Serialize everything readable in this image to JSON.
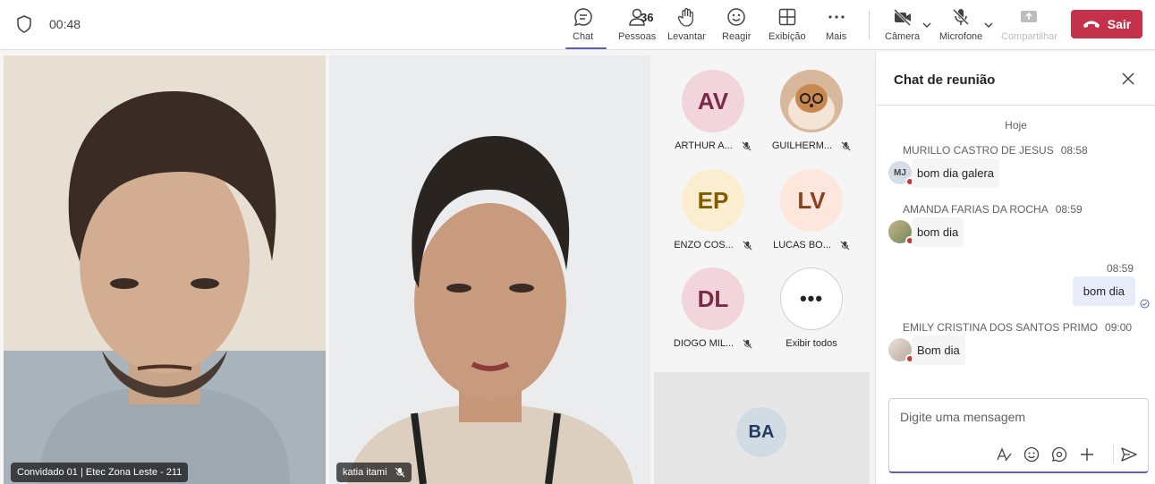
{
  "meeting": {
    "timer": "00:48"
  },
  "toolbar": {
    "chat": "Chat",
    "people": "Pessoas",
    "people_count": "36",
    "raise": "Levantar",
    "react": "Reagir",
    "view": "Exibição",
    "more": "Mais",
    "camera": "Câmera",
    "mic": "Microfone",
    "share": "Compartilhar",
    "leave": "Sair",
    "leave_color": "#c4314b",
    "accent": "#5b5fc7"
  },
  "videos": {
    "left_name": "Convidado 01 | Etec Zona Leste - 211",
    "center_name": "katia itami"
  },
  "participants": [
    {
      "initials": "AV",
      "name": "ARTHUR A...",
      "bg": "#f1d4dc",
      "fg": "#7a2a44"
    },
    {
      "initials": "",
      "name": "GUILHERM...",
      "bg": "#e7c9ad",
      "fg": "#5a3a22",
      "icon": "dog-photo-avatar"
    },
    {
      "initials": "EP",
      "name": "ENZO COS...",
      "bg": "#fbeed0",
      "fg": "#835a00"
    },
    {
      "initials": "LV",
      "name": "LUCAS BO...",
      "bg": "#fde7dc",
      "fg": "#8a3f1e"
    },
    {
      "initials": "DL",
      "name": "DIOGO MIL...",
      "bg": "#f1d4dc",
      "fg": "#7a2a44"
    },
    {
      "initials": "",
      "name": "Exibir todos",
      "icon": "more-icon"
    }
  ],
  "bottom_tile": {
    "initials": "BA"
  },
  "chat": {
    "title": "Chat de reunião",
    "day": "Hoje",
    "messages": [
      {
        "sender": "MURILLO CASTRO DE JESUS",
        "time": "08:58",
        "text": "bom dia  galera",
        "avatar": "MJ"
      },
      {
        "sender": "AMANDA FARIAS DA ROCHA",
        "time": "08:59",
        "text": "bom dia",
        "avatar": ""
      },
      {
        "sender": "",
        "time": "08:59",
        "text": "bom dia",
        "avatar": "",
        "mine": true
      },
      {
        "sender": "EMILY CRISTINA DOS SANTOS PRIMO",
        "time": "09:00",
        "text": "Bom dia",
        "avatar": ""
      }
    ],
    "placeholder": "Digite uma mensagem"
  }
}
